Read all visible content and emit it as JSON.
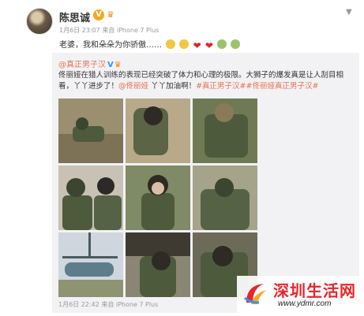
{
  "post": {
    "author_name": "陈思诚",
    "meta": "1月6日 23:07 来自 iPhone 7 Plus",
    "text": "老婆，我和朵朵为你骄傲……",
    "emojis": [
      "ok-face-icon",
      "ok-face-icon",
      "heart-icon",
      "heart-icon",
      "sad-face-icon",
      "sad-face-icon"
    ]
  },
  "repost": {
    "author": "@真正男子汉",
    "text_prefix": "佟丽娅在猎人训练的表现已经突破了体力和心理的极限。大狮子的爆发真是让人刮目相看，丫丫进步了！",
    "mention": "@佟丽娅",
    "text_middle": "丫丫加油啊！",
    "tags": "#真正男子汉##佟丽娅真正男子汉#",
    "meta": "1月6日 22:42 来自 iPhone 7 Plus"
  },
  "watermark": {
    "title": "深圳生活网",
    "url": "www.ydmr.com"
  },
  "colors": {
    "accent": "#eb7350",
    "verified": "#2b9ae8",
    "watermark_red": "#e8262b"
  }
}
